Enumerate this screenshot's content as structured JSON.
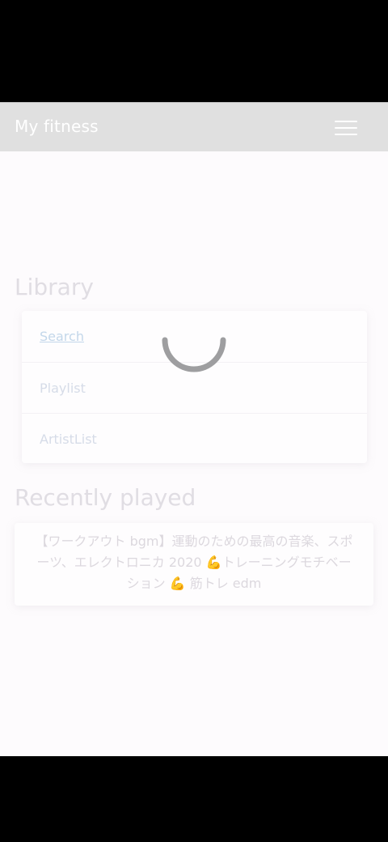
{
  "app": {
    "title": "My fitness"
  },
  "navbar": {
    "menu_icon": "hamburger-menu-icon"
  },
  "library": {
    "title": "Library",
    "items": [
      {
        "label": "Search"
      },
      {
        "label": "Playlist"
      },
      {
        "label": "ArtistList"
      }
    ]
  },
  "loading": {
    "icon": "loading-spinner-icon"
  },
  "recently_played": {
    "title": "Recently played",
    "items": [
      {
        "title": "【ワークアウト bgm】運動のための最高の音楽、スポーツ、エレクトロニカ 2020 💪トレーニングモチベーション 💪 筋トレ edm"
      }
    ]
  }
}
